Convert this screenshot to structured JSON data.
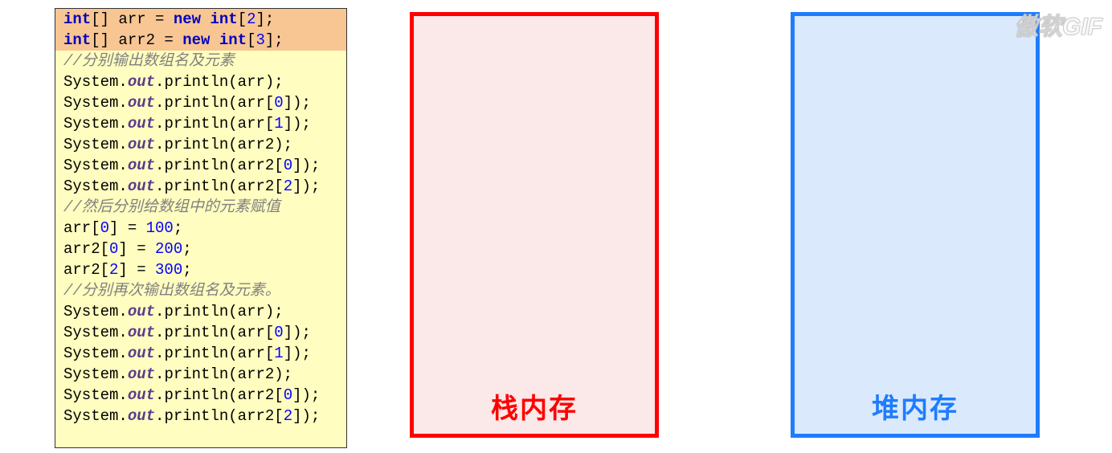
{
  "code": {
    "lines": [
      {
        "highlight": true,
        "tokens": [
          {
            "t": "int",
            "c": "kw"
          },
          {
            "t": "[] arr = "
          },
          {
            "t": "new int",
            "c": "kw"
          },
          {
            "t": "["
          },
          {
            "t": "2",
            "c": "num"
          },
          {
            "t": "];"
          }
        ]
      },
      {
        "highlight": true,
        "tokens": [
          {
            "t": "int",
            "c": "kw"
          },
          {
            "t": "[] arr2 = "
          },
          {
            "t": "new int",
            "c": "kw"
          },
          {
            "t": "["
          },
          {
            "t": "3",
            "c": "num"
          },
          {
            "t": "];"
          }
        ]
      },
      {
        "highlight": false,
        "tokens": [
          {
            "t": "//分别输出数组名及元素",
            "c": "comment"
          }
        ]
      },
      {
        "highlight": false,
        "tokens": [
          {
            "t": "System."
          },
          {
            "t": "out",
            "c": "field"
          },
          {
            "t": ".println(arr);"
          }
        ]
      },
      {
        "highlight": false,
        "tokens": [
          {
            "t": "System."
          },
          {
            "t": "out",
            "c": "field"
          },
          {
            "t": ".println(arr["
          },
          {
            "t": "0",
            "c": "num"
          },
          {
            "t": "]);"
          }
        ]
      },
      {
        "highlight": false,
        "tokens": [
          {
            "t": "System."
          },
          {
            "t": "out",
            "c": "field"
          },
          {
            "t": ".println(arr["
          },
          {
            "t": "1",
            "c": "num"
          },
          {
            "t": "]);"
          }
        ]
      },
      {
        "highlight": false,
        "tokens": [
          {
            "t": "System."
          },
          {
            "t": "out",
            "c": "field"
          },
          {
            "t": ".println(arr2);"
          }
        ]
      },
      {
        "highlight": false,
        "tokens": [
          {
            "t": "System."
          },
          {
            "t": "out",
            "c": "field"
          },
          {
            "t": ".println(arr2["
          },
          {
            "t": "0",
            "c": "num"
          },
          {
            "t": "]);"
          }
        ]
      },
      {
        "highlight": false,
        "tokens": [
          {
            "t": "System."
          },
          {
            "t": "out",
            "c": "field"
          },
          {
            "t": ".println(arr2["
          },
          {
            "t": "2",
            "c": "num"
          },
          {
            "t": "]);"
          }
        ]
      },
      {
        "highlight": false,
        "tokens": [
          {
            "t": "//然后分别给数组中的元素赋值",
            "c": "comment"
          }
        ]
      },
      {
        "highlight": false,
        "tokens": [
          {
            "t": "arr["
          },
          {
            "t": "0",
            "c": "num"
          },
          {
            "t": "] = "
          },
          {
            "t": "100",
            "c": "num"
          },
          {
            "t": ";"
          }
        ]
      },
      {
        "highlight": false,
        "tokens": [
          {
            "t": "arr2["
          },
          {
            "t": "0",
            "c": "num"
          },
          {
            "t": "] = "
          },
          {
            "t": "200",
            "c": "num"
          },
          {
            "t": ";"
          }
        ]
      },
      {
        "highlight": false,
        "tokens": [
          {
            "t": "arr2["
          },
          {
            "t": "2",
            "c": "num"
          },
          {
            "t": "] = "
          },
          {
            "t": "300",
            "c": "num"
          },
          {
            "t": ";"
          }
        ]
      },
      {
        "highlight": false,
        "tokens": [
          {
            "t": "//分别再次输出数组名及元素。",
            "c": "comment"
          }
        ]
      },
      {
        "highlight": false,
        "tokens": [
          {
            "t": "System."
          },
          {
            "t": "out",
            "c": "field"
          },
          {
            "t": ".println(arr);"
          }
        ]
      },
      {
        "highlight": false,
        "tokens": [
          {
            "t": "System."
          },
          {
            "t": "out",
            "c": "field"
          },
          {
            "t": ".println(arr["
          },
          {
            "t": "0",
            "c": "num"
          },
          {
            "t": "]);"
          }
        ]
      },
      {
        "highlight": false,
        "tokens": [
          {
            "t": "System."
          },
          {
            "t": "out",
            "c": "field"
          },
          {
            "t": ".println(arr["
          },
          {
            "t": "1",
            "c": "num"
          },
          {
            "t": "]);"
          }
        ]
      },
      {
        "highlight": false,
        "tokens": [
          {
            "t": "System."
          },
          {
            "t": "out",
            "c": "field"
          },
          {
            "t": ".println(arr2);"
          }
        ]
      },
      {
        "highlight": false,
        "tokens": [
          {
            "t": "System."
          },
          {
            "t": "out",
            "c": "field"
          },
          {
            "t": ".println(arr2["
          },
          {
            "t": "0",
            "c": "num"
          },
          {
            "t": "]);"
          }
        ]
      },
      {
        "highlight": false,
        "tokens": [
          {
            "t": "System."
          },
          {
            "t": "out",
            "c": "field"
          },
          {
            "t": ".println(arr2["
          },
          {
            "t": "2",
            "c": "num"
          },
          {
            "t": "]);"
          }
        ]
      }
    ]
  },
  "stack": {
    "label": "栈内存"
  },
  "heap": {
    "label": "堆内存"
  },
  "watermark": "傲软GIF"
}
